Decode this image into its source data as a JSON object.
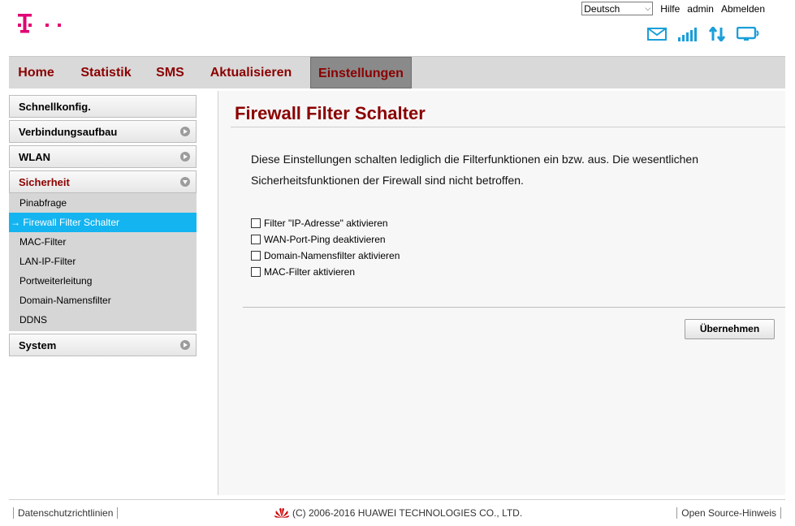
{
  "header": {
    "logo_icon": "telekom-t-logo",
    "brand_color": "#e20074",
    "language": "Deutsch",
    "links": {
      "help": "Hilfe",
      "user": "admin",
      "logout": "Abmelden"
    },
    "status_icons": [
      "mail-icon",
      "signal-strength-icon",
      "data-transfer-icon",
      "connected-device-icon"
    ],
    "status_color": "#1a9fd9"
  },
  "nav": {
    "items": [
      {
        "label": "Home"
      },
      {
        "label": "Statistik"
      },
      {
        "label": "SMS"
      },
      {
        "label": "Aktualisieren"
      },
      {
        "label": "Einstellungen"
      }
    ],
    "active": "Einstellungen",
    "text_color": "#8b0000"
  },
  "sidebar": {
    "quick": "Schnellkonfig.",
    "connection": "Verbindungsaufbau",
    "wlan": "WLAN",
    "security": {
      "label": "Sicherheit",
      "items": [
        {
          "label": "Pinabfrage"
        },
        {
          "label": "→ Firewall Filter Schalter"
        },
        {
          "label": "MAC-Filter"
        },
        {
          "label": "LAN-IP-Filter"
        },
        {
          "label": "Portweiterleitung"
        },
        {
          "label": "Domain-Namensfilter"
        },
        {
          "label": "DDNS"
        }
      ]
    },
    "system": "System",
    "active_color": "#14b4f0"
  },
  "main": {
    "title": "Firewall Filter Schalter",
    "description": "Diese Einstellungen schalten lediglich die Filterfunktionen ein bzw. aus. Die wesentlichen Sicherheitsfunktionen der Firewall sind nicht betroffen.",
    "checkboxes": [
      {
        "label": "Filter \"IP-Adresse\" aktivieren",
        "checked": false
      },
      {
        "label": "WAN-Port-Ping deaktivieren",
        "checked": false
      },
      {
        "label": "Domain-Namensfilter aktivieren",
        "checked": false
      },
      {
        "label": "MAC-Filter aktivieren",
        "checked": false
      }
    ],
    "apply_button": "Übernehmen"
  },
  "footer": {
    "privacy": "Datenschutzrichtlinien",
    "copyright": "(C) 2006-2016 HUAWEI TECHNOLOGIES CO., LTD.",
    "copyright_icon": "huawei-logo-icon",
    "open_source": "Open Source-Hinweis"
  }
}
